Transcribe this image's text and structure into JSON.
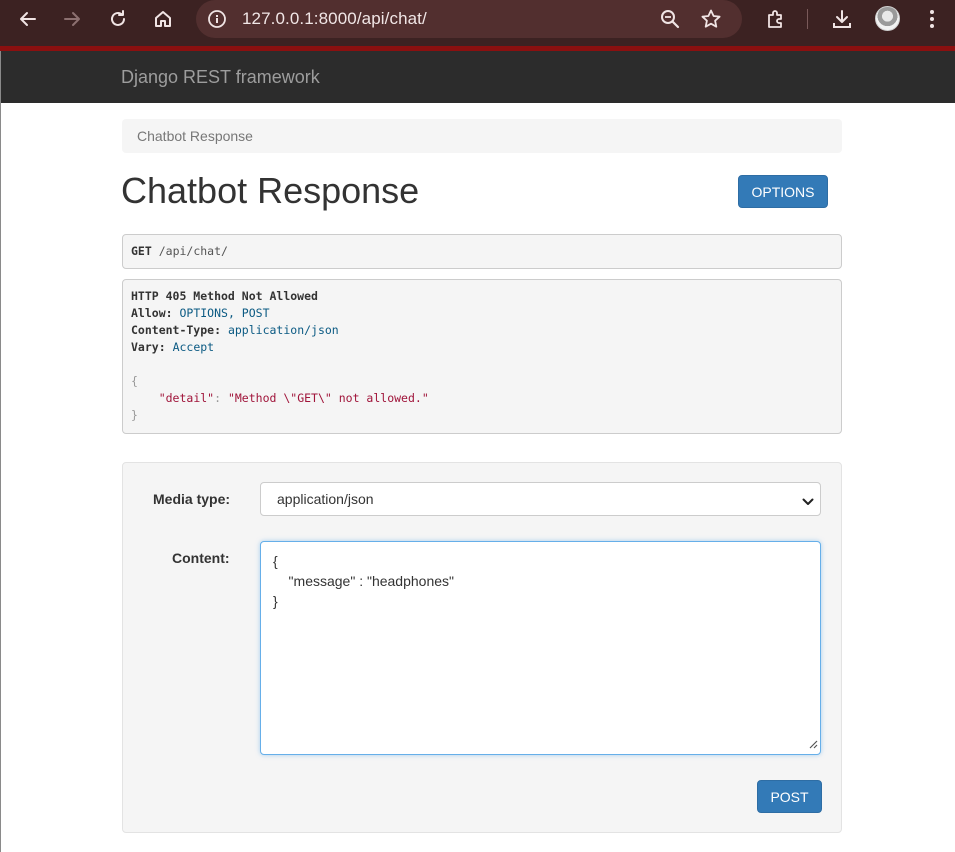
{
  "browser": {
    "url": "127.0.0.1:8000/api/chat/",
    "icons": [
      "back-icon",
      "forward-icon",
      "reload-icon",
      "home-icon",
      "site-info-icon",
      "zoom-icon",
      "bookmark-star-icon",
      "extensions-icon",
      "download-icon",
      "profile-avatar",
      "menu-kebab-icon"
    ]
  },
  "navbar": {
    "brand": "Django REST framework"
  },
  "breadcrumb": {
    "current": "Chatbot Response"
  },
  "page": {
    "title": "Chatbot Response",
    "options_label": "OPTIONS"
  },
  "request": {
    "method": "GET",
    "path": "/api/chat/"
  },
  "response": {
    "status_line": "HTTP 405 Method Not Allowed",
    "headers": [
      {
        "name": "Allow:",
        "value": "OPTIONS, POST"
      },
      {
        "name": "Content-Type:",
        "value": "application/json"
      },
      {
        "name": "Vary:",
        "value": "Accept"
      }
    ],
    "body": {
      "open": "{",
      "key": "\"detail\"",
      "colon": ": ",
      "value": "\"Method \\\"GET\\\" not allowed.\"",
      "close": "}"
    }
  },
  "form": {
    "media_type_label": "Media type:",
    "media_type_value": "application/json",
    "content_label": "Content:",
    "content_lines": [
      "{",
      "    \"message\" : \"headphones\"",
      "}"
    ],
    "submit_label": "POST"
  },
  "colors": {
    "primary": "#337ab7",
    "navbar": "#2c2c2c",
    "chrome": "#3c2222",
    "chrome_accent": "#8b1010"
  }
}
